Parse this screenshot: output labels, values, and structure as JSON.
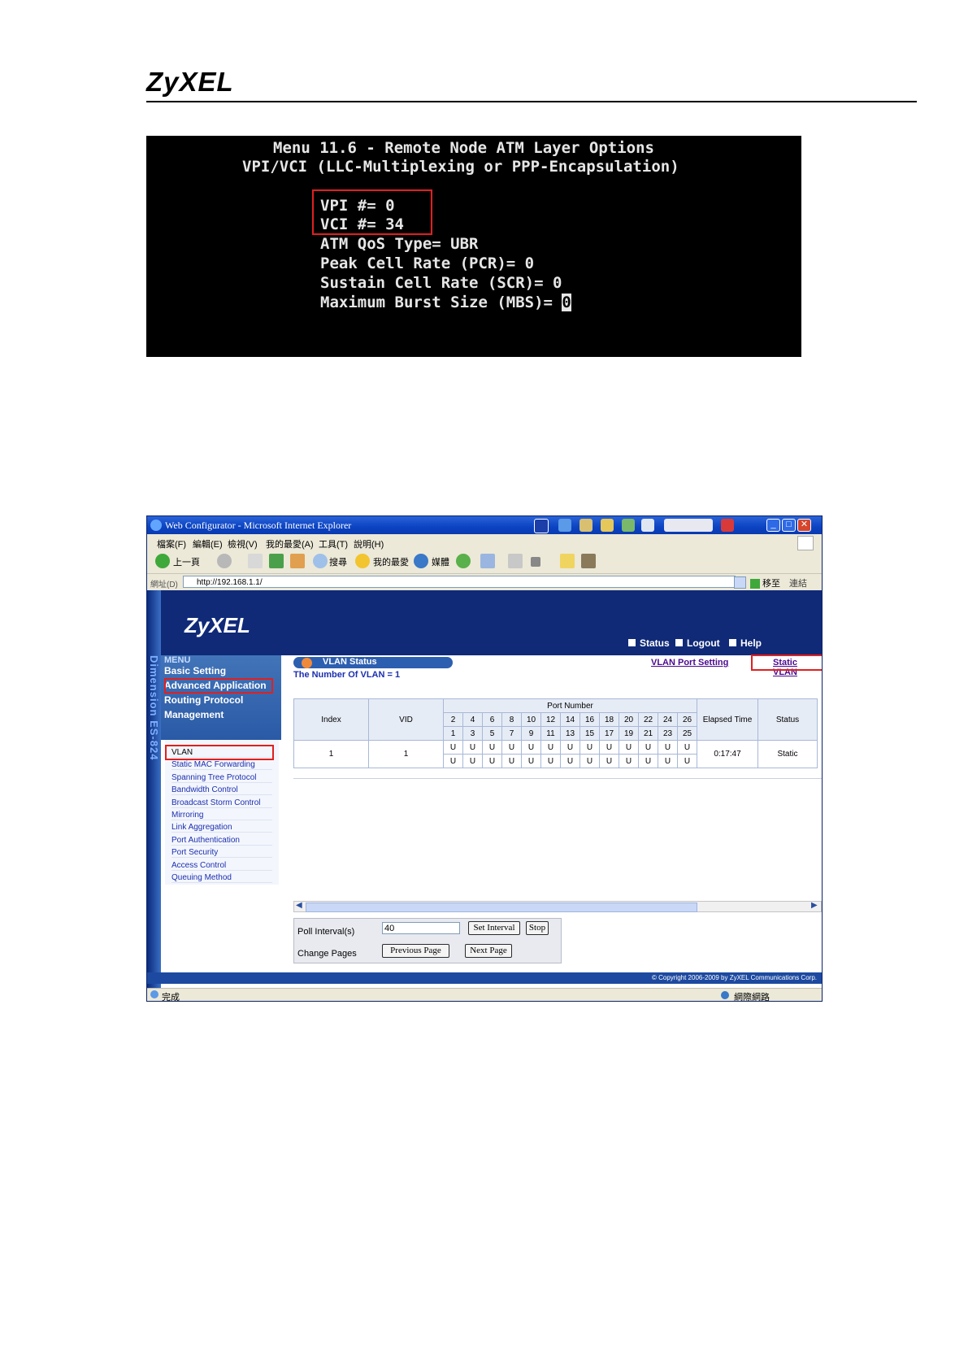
{
  "doc": {
    "logo": "ZyXEL"
  },
  "terminal": {
    "lines": [
      "Menu 11.6 - Remote Node ATM Layer Options",
      "VPI/VCI (LLC-Multiplexing or PPP-Encapsulation)",
      "VPI #= 0",
      "VCI #= 34",
      "ATM QoS Type= UBR",
      "Peak Cell Rate (PCR)= 0",
      "Sustain Cell Rate (SCR)= 0",
      "Maximum Burst Size (MBS)= ",
      "0"
    ]
  },
  "browser": {
    "title": "Web Configurator - Microsoft Internet Explorer",
    "menu": [
      "檔案(F)",
      "編輯(E)",
      "檢視(V)",
      "我的最愛(A)",
      "工具(T)",
      "說明(H)"
    ],
    "toolbar": {
      "back": "上一頁",
      "search": "搜尋",
      "favorites": "我的最愛",
      "media": "媒體"
    },
    "address": {
      "label": "網址(D)",
      "url": "http://192.168.1.1/",
      "go": "移至",
      "links": "連結"
    },
    "status_left": "完成",
    "status_right": "網際網路"
  },
  "app": {
    "logo": "ZyXEL",
    "product": "Dimension ES-824",
    "top_links": [
      "Status",
      "Logout",
      "Help"
    ],
    "menu_header": "MENU",
    "menu_items": [
      "Basic Setting",
      "Advanced Application",
      "Routing Protocol",
      "Management"
    ],
    "submenu": [
      "VLAN",
      "Static MAC Forwarding",
      "Spanning Tree Protocol",
      "Bandwidth Control",
      "Broadcast Storm Control",
      "Mirroring",
      "Link Aggregation",
      "Port Authentication",
      "Port Security",
      "Access Control",
      "Queuing Method"
    ],
    "section_title": "VLAN Status",
    "vlan_count": "The Number Of VLAN = 1",
    "link_port_setting": "VLAN Port Setting",
    "link_static_vlan": "Static VLAN",
    "table": {
      "col_index": "Index",
      "col_vid": "VID",
      "col_port": "Port Number",
      "col_elapsed": "Elapsed Time",
      "col_status": "Status",
      "ports_even": [
        "2",
        "4",
        "6",
        "8",
        "10",
        "12",
        "14",
        "16",
        "18",
        "20",
        "22",
        "24",
        "26"
      ],
      "ports_odd": [
        "1",
        "3",
        "5",
        "7",
        "9",
        "11",
        "13",
        "15",
        "17",
        "19",
        "21",
        "23",
        "25"
      ],
      "row": {
        "index": "1",
        "vid": "1",
        "top": [
          "U",
          "U",
          "U",
          "U",
          "U",
          "U",
          "U",
          "U",
          "U",
          "U",
          "U",
          "U",
          "U"
        ],
        "bottom": [
          "U",
          "U",
          "U",
          "U",
          "U",
          "U",
          "U",
          "U",
          "U",
          "U",
          "U",
          "U",
          "U"
        ],
        "elapsed": "0:17:47",
        "status": "Static"
      }
    },
    "poll_label": "Poll Interval(s)",
    "poll_value": "40",
    "set_interval": "Set Interval",
    "stop": "Stop",
    "change_pages": "Change Pages",
    "prev_page": "Previous Page",
    "next_page": "Next Page",
    "copyright": "© Copyright 2006-2009 by ZyXEL Communications Corp."
  },
  "colors": {
    "highlight_box": "#e0201f",
    "banner": "#102a78",
    "link": "#4b0a8f"
  }
}
